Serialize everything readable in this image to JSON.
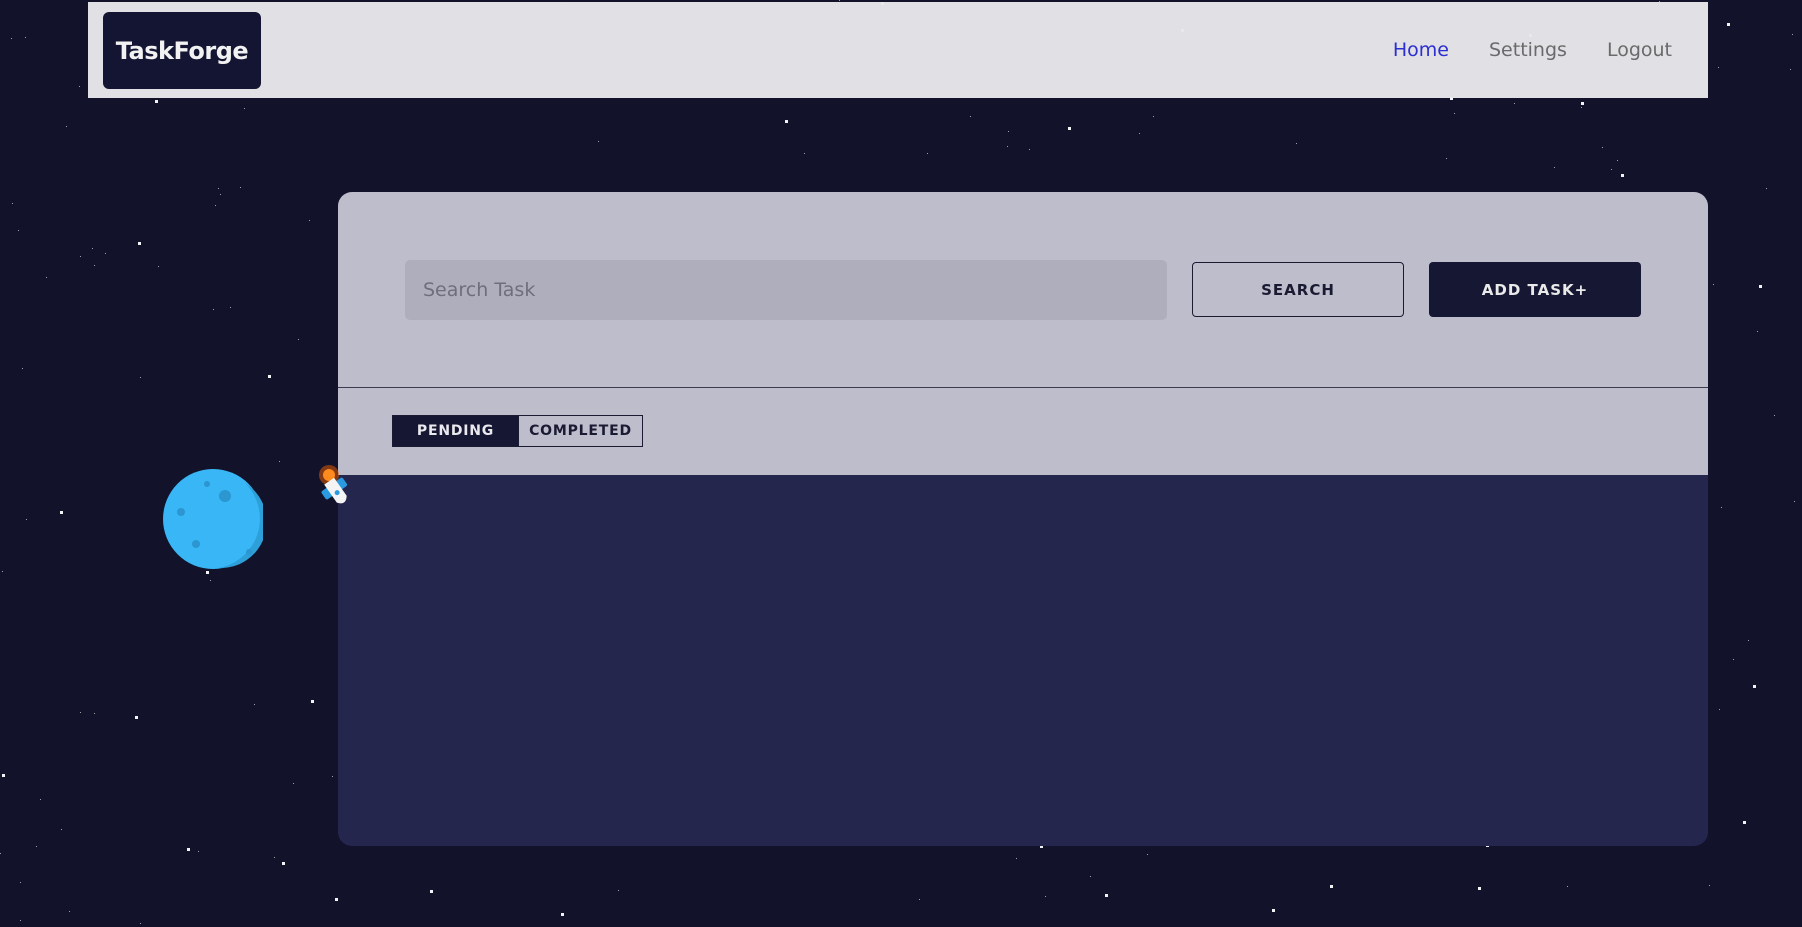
{
  "app": {
    "brand": "TaskForge"
  },
  "nav": {
    "items": [
      {
        "label": "Home",
        "active": true
      },
      {
        "label": "Settings",
        "active": false
      },
      {
        "label": "Logout",
        "active": false
      }
    ]
  },
  "search": {
    "placeholder": "Search Task",
    "value": "",
    "search_label": "SEARCH",
    "add_label": "ADD TASK+"
  },
  "tabs": [
    {
      "label": "PENDING",
      "active": true
    },
    {
      "label": "COMPLETED",
      "active": false
    }
  ],
  "decor": {
    "planet": "planet-icon",
    "rocket": "rocket-icon"
  },
  "colors": {
    "background": "#12132a",
    "panel_body": "#25264e",
    "accent_dark": "#161733",
    "nav_active": "#2b2ed0",
    "planet": "#38b6f6"
  }
}
